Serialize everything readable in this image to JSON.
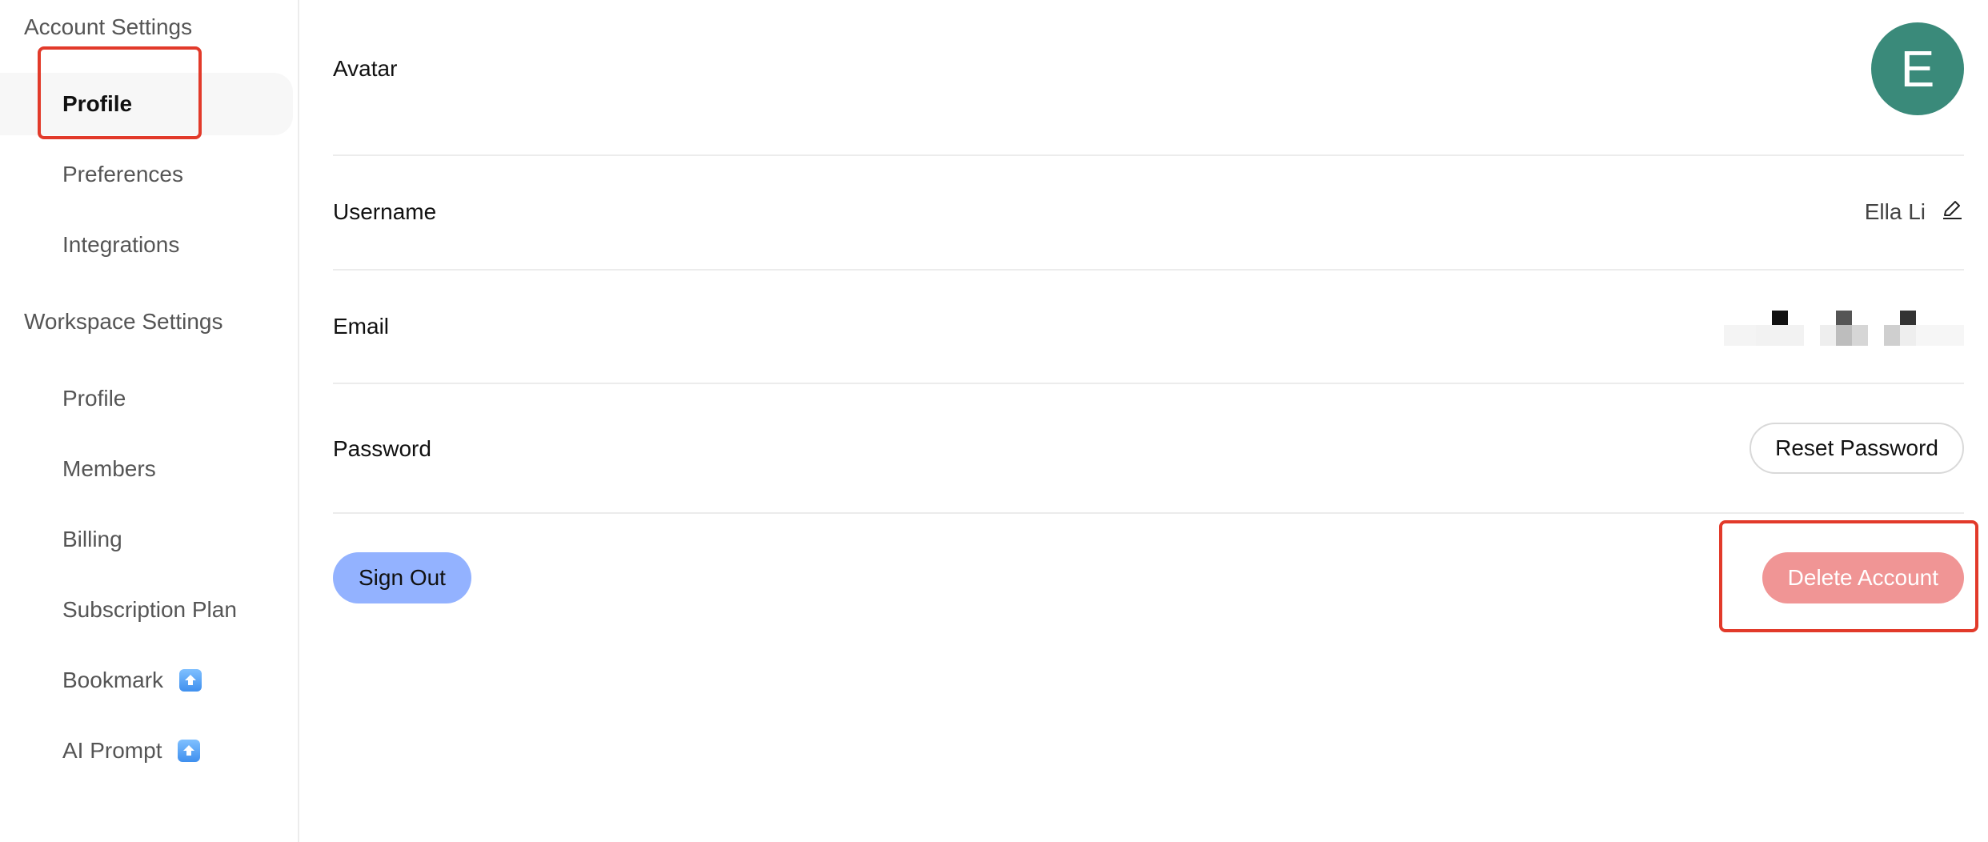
{
  "sidebar": {
    "account_title": "Account Settings",
    "account_items": [
      {
        "label": "Profile"
      },
      {
        "label": "Preferences"
      },
      {
        "label": "Integrations"
      }
    ],
    "workspace_title": "Workspace Settings",
    "workspace_items": [
      {
        "label": "Profile"
      },
      {
        "label": "Members"
      },
      {
        "label": "Billing"
      },
      {
        "label": "Subscription Plan"
      },
      {
        "label": "Bookmark",
        "badge_icon": "upgrade-arrow-icon"
      },
      {
        "label": "AI Prompt",
        "badge_icon": "upgrade-arrow-icon"
      }
    ]
  },
  "profile": {
    "avatar_label": "Avatar",
    "avatar_initial": "E",
    "avatar_color": "#3a8a7a",
    "username_label": "Username",
    "username_value": "Ella Li",
    "email_label": "Email",
    "password_label": "Password",
    "reset_password_label": "Reset Password",
    "sign_out_label": "Sign Out",
    "delete_account_label": "Delete Account"
  },
  "colors": {
    "highlight": "#e23a2a",
    "sign_out_bg": "#93b2ff",
    "delete_bg": "#f09595"
  }
}
